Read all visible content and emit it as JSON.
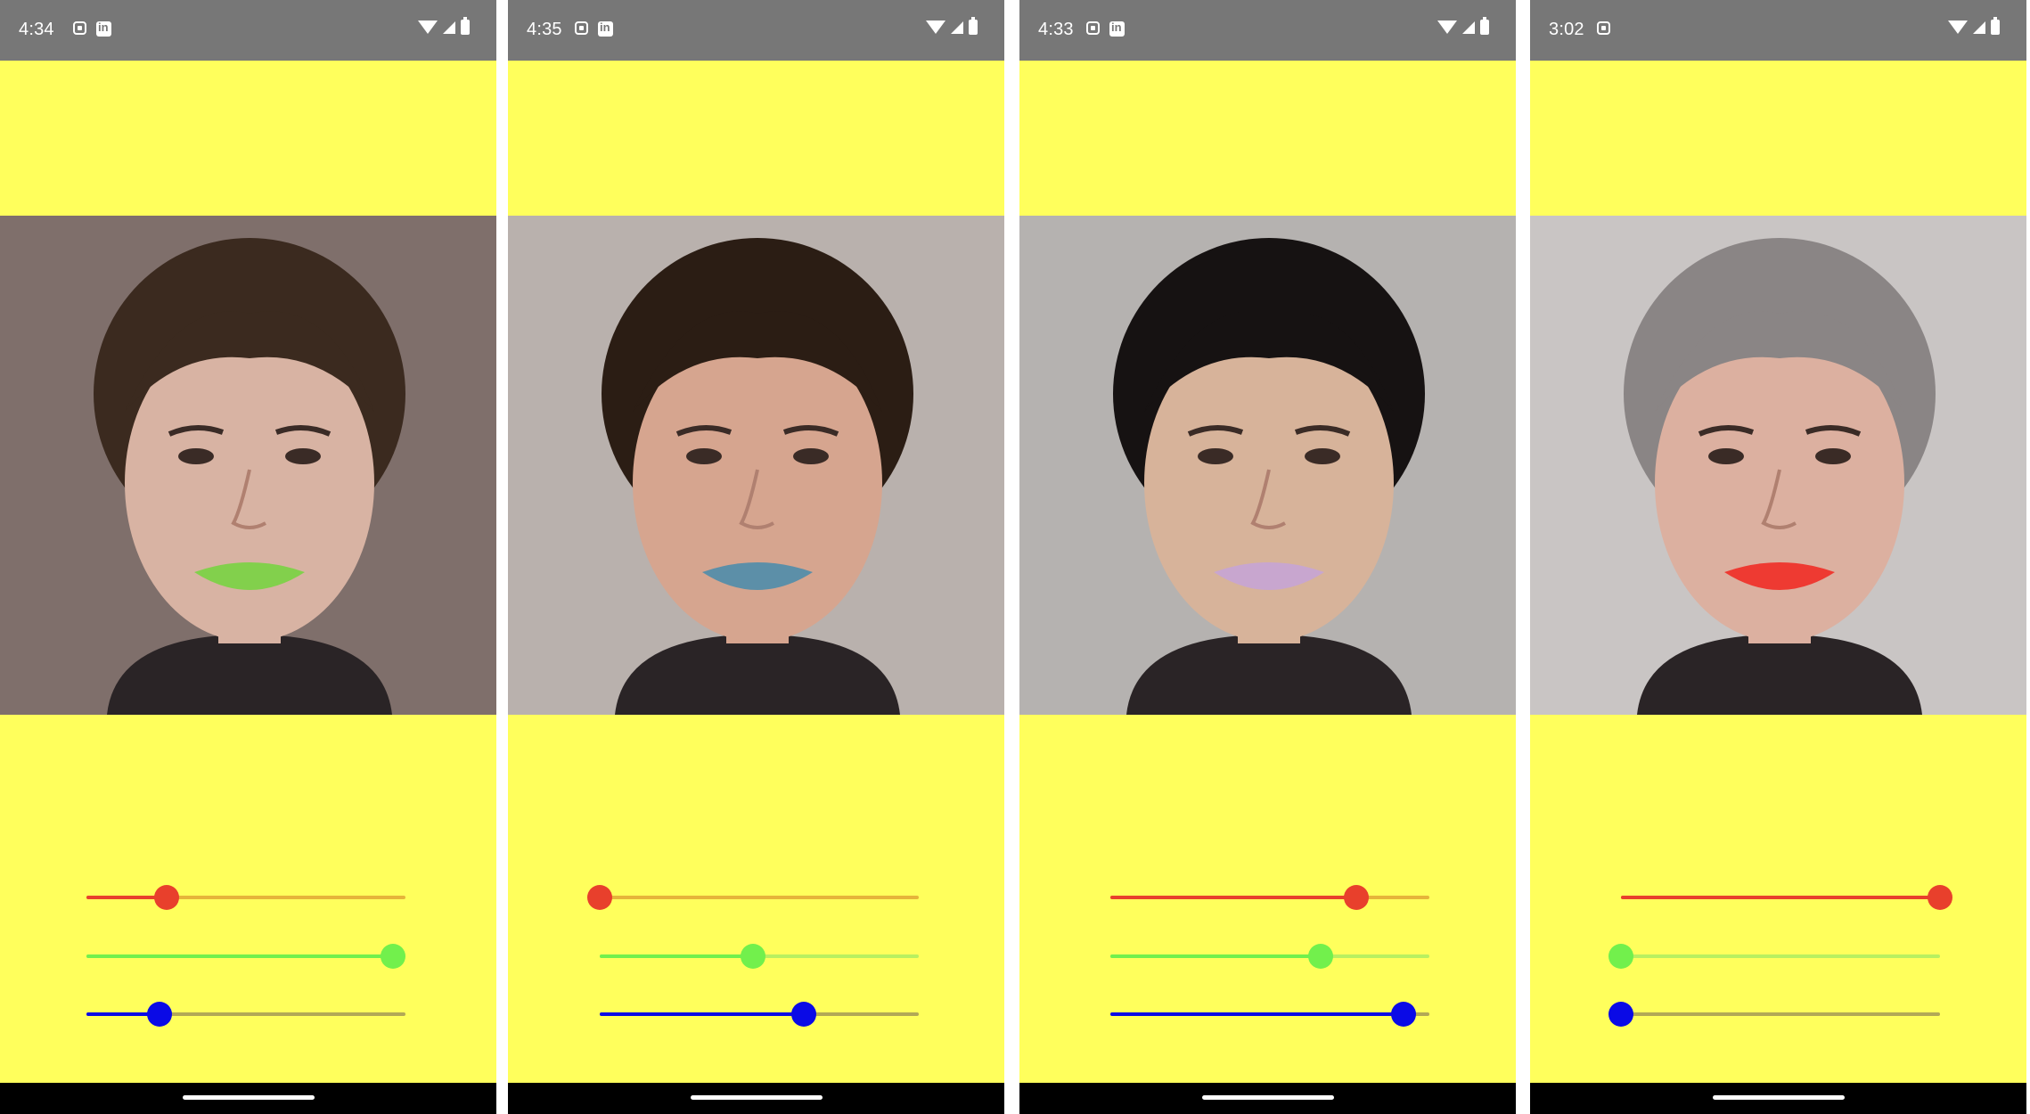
{
  "screens": [
    {
      "status": {
        "time": "4:34",
        "icons": [
          "notification-icon",
          "linkedin-icon",
          "wifi-icon",
          "signal-icon",
          "battery-icon"
        ]
      },
      "photo": {
        "lip_color": "#82d04c",
        "hair_color": "#3b2a1f",
        "skin_color": "#d8b3a3",
        "background_color": "#7f6f6b"
      },
      "sliders": {
        "red": 0.25,
        "green": 0.96,
        "blue": 0.23
      }
    },
    {
      "status": {
        "time": "4:35",
        "icons": [
          "notification-icon",
          "linkedin-icon",
          "wifi-icon",
          "signal-icon",
          "battery-icon"
        ]
      },
      "photo": {
        "lip_color": "#5c8fa8",
        "hair_color": "#2b1d14",
        "skin_color": "#d6a58f",
        "background_color": "#b9b1ad"
      },
      "sliders": {
        "red": 0.0,
        "green": 0.48,
        "blue": 0.64
      }
    },
    {
      "status": {
        "time": "4:33",
        "icons": [
          "notification-icon",
          "linkedin-icon",
          "wifi-icon",
          "signal-icon",
          "battery-icon"
        ]
      },
      "photo": {
        "lip_color": "#c8a6cf",
        "hair_color": "#161212",
        "skin_color": "#d7b39a",
        "background_color": "#b5b2b0"
      },
      "sliders": {
        "red": 0.77,
        "green": 0.66,
        "blue": 0.92
      }
    },
    {
      "status": {
        "time": "3:02",
        "icons": [
          "notification-icon",
          "wifi-icon",
          "signal-icon",
          "battery-icon"
        ]
      },
      "photo": {
        "lip_color": "#ee3a32",
        "hair_color": "#8a8585",
        "skin_color": "#dcb0a0",
        "background_color": "#c9c5c4"
      },
      "sliders": {
        "red": 1.0,
        "green": 0.0,
        "blue": 0.0
      }
    }
  ],
  "colors": {
    "app_background": "#ffff5c",
    "status_bar": "#777777",
    "nav_bar": "#000000",
    "slider_red": "#e8402c",
    "slider_green": "#72f04c",
    "slider_blue": "#0a0ae6"
  }
}
